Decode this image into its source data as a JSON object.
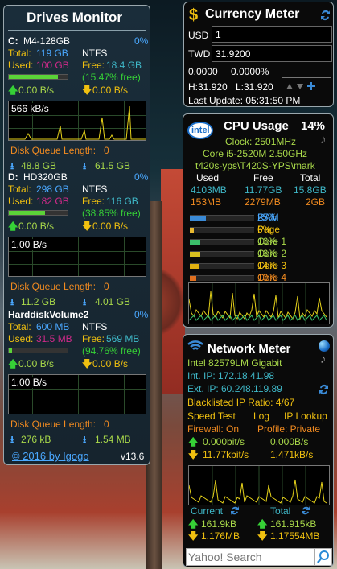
{
  "drives": {
    "title": "Drives Monitor",
    "list": [
      {
        "letter": "C:",
        "name": "M4-128GB",
        "pct": "0%",
        "total_label": "Total:",
        "total": "119 GB",
        "fs": "NTFS",
        "used_label": "Used:",
        "used": "100 GB",
        "free_label": "Free:",
        "free": "18.4 GB",
        "free_pct": "(15.47% free)",
        "usage_fraction": 0.84,
        "read": "0.00 B/s",
        "write": "0.00 B/s",
        "graph_label": "566 kB/s",
        "queue": "Disk Queue Length:",
        "queue_val": "0",
        "read_total": "48.8 GB",
        "write_total": "61.5 GB"
      },
      {
        "letter": "D:",
        "name": "HD320GB",
        "pct": "0%",
        "total_label": "Total:",
        "total": "298 GB",
        "fs": "NTFS",
        "used_label": "Used:",
        "used": "182 GB",
        "free_label": "Free:",
        "free": "116 GB",
        "free_pct": "(38.85% free)",
        "usage_fraction": 0.61,
        "read": "0.00 B/s",
        "write": "0.00 B/s",
        "graph_label": "1.00 B/s",
        "queue": "Disk Queue Length:",
        "queue_val": "0",
        "read_total": "11.2 GB",
        "write_total": "4.01 GB"
      },
      {
        "letter": "",
        "name": "HarddiskVolume2",
        "pct": "0%",
        "total_label": "Total:",
        "total": "600 MB",
        "fs": "NTFS",
        "used_label": "Used:",
        "used": "31.5 MB",
        "free_label": "Free:",
        "free": "569 MB",
        "free_pct": "(94.76% free)",
        "usage_fraction": 0.05,
        "read": "0.00 B/s",
        "write": "0.00 B/s",
        "graph_label": "1.00 B/s",
        "queue": "Disk Queue Length:",
        "queue_val": "0",
        "read_total": "276 kB",
        "write_total": "1.54 MB"
      }
    ],
    "copyright": "© 2016 by Igogo",
    "version": "v13.6"
  },
  "currency": {
    "title": "Currency Meter",
    "from_code": "USD",
    "from_value": "1",
    "to_code": "TWD",
    "to_value": "31.9200",
    "change": "0.0000",
    "change_pct": "0.0000%",
    "high": "H:31.920",
    "low": "L:31.920",
    "updated": "Last Update: 05:31:50 PM"
  },
  "cpu": {
    "brand": "intel",
    "title": "CPU Usage",
    "total": "14%",
    "clock": "Clock: 2501MHz",
    "model": "Core i5-2520M 2.50GHz",
    "host": "t420s-yps\\T420S-YPS\\mark",
    "headers": [
      "Used",
      "Free",
      "Total"
    ],
    "rows": [
      [
        "4103MB",
        "11.77GB",
        "15.8GB"
      ],
      [
        "153MB",
        "2279MB",
        "2GB"
      ]
    ],
    "meters": [
      {
        "label": "RAM",
        "value": "25%",
        "fraction": 0.25,
        "color": "#3a8ad6"
      },
      {
        "label": "Page",
        "value": "6%",
        "fraction": 0.06,
        "color": "#e8b830"
      },
      {
        "label": "Core 1",
        "value": "16%",
        "fraction": 0.16,
        "color": "#3bbf6a"
      },
      {
        "label": "Core 2",
        "value": "16%",
        "fraction": 0.16,
        "color": "#d8c020"
      },
      {
        "label": "Core 3",
        "value": "14%",
        "fraction": 0.14,
        "color": "#e0b010"
      },
      {
        "label": "Core 4",
        "value": "10%",
        "fraction": 0.1,
        "color": "#e07020"
      }
    ]
  },
  "net": {
    "title": "Network Meter",
    "adapter": "Intel 82579LM Gigabit",
    "int_ip": "Int. IP: 172.18.41.98",
    "ext_ip": "Ext. IP: 60.248.119.89",
    "blacklist": "Blacklisted IP Ratio: 4/67",
    "links": [
      "Speed Test",
      "Log",
      "IP Lookup"
    ],
    "firewall": "Firewall: On",
    "profile": "Profile: Private",
    "up_bits": "0.000bit/s",
    "up_bytes": "0.000B/s",
    "down_bits": "11.77kbit/s",
    "down_bytes": "1.471kB/s",
    "current_label": "Current",
    "total_label": "Total",
    "cur_up": "161.9kB",
    "cur_down": "1.176MB",
    "tot_up": "161.915kB",
    "tot_down": "1.17554MB",
    "search_placeholder": "Yahoo! Search"
  }
}
